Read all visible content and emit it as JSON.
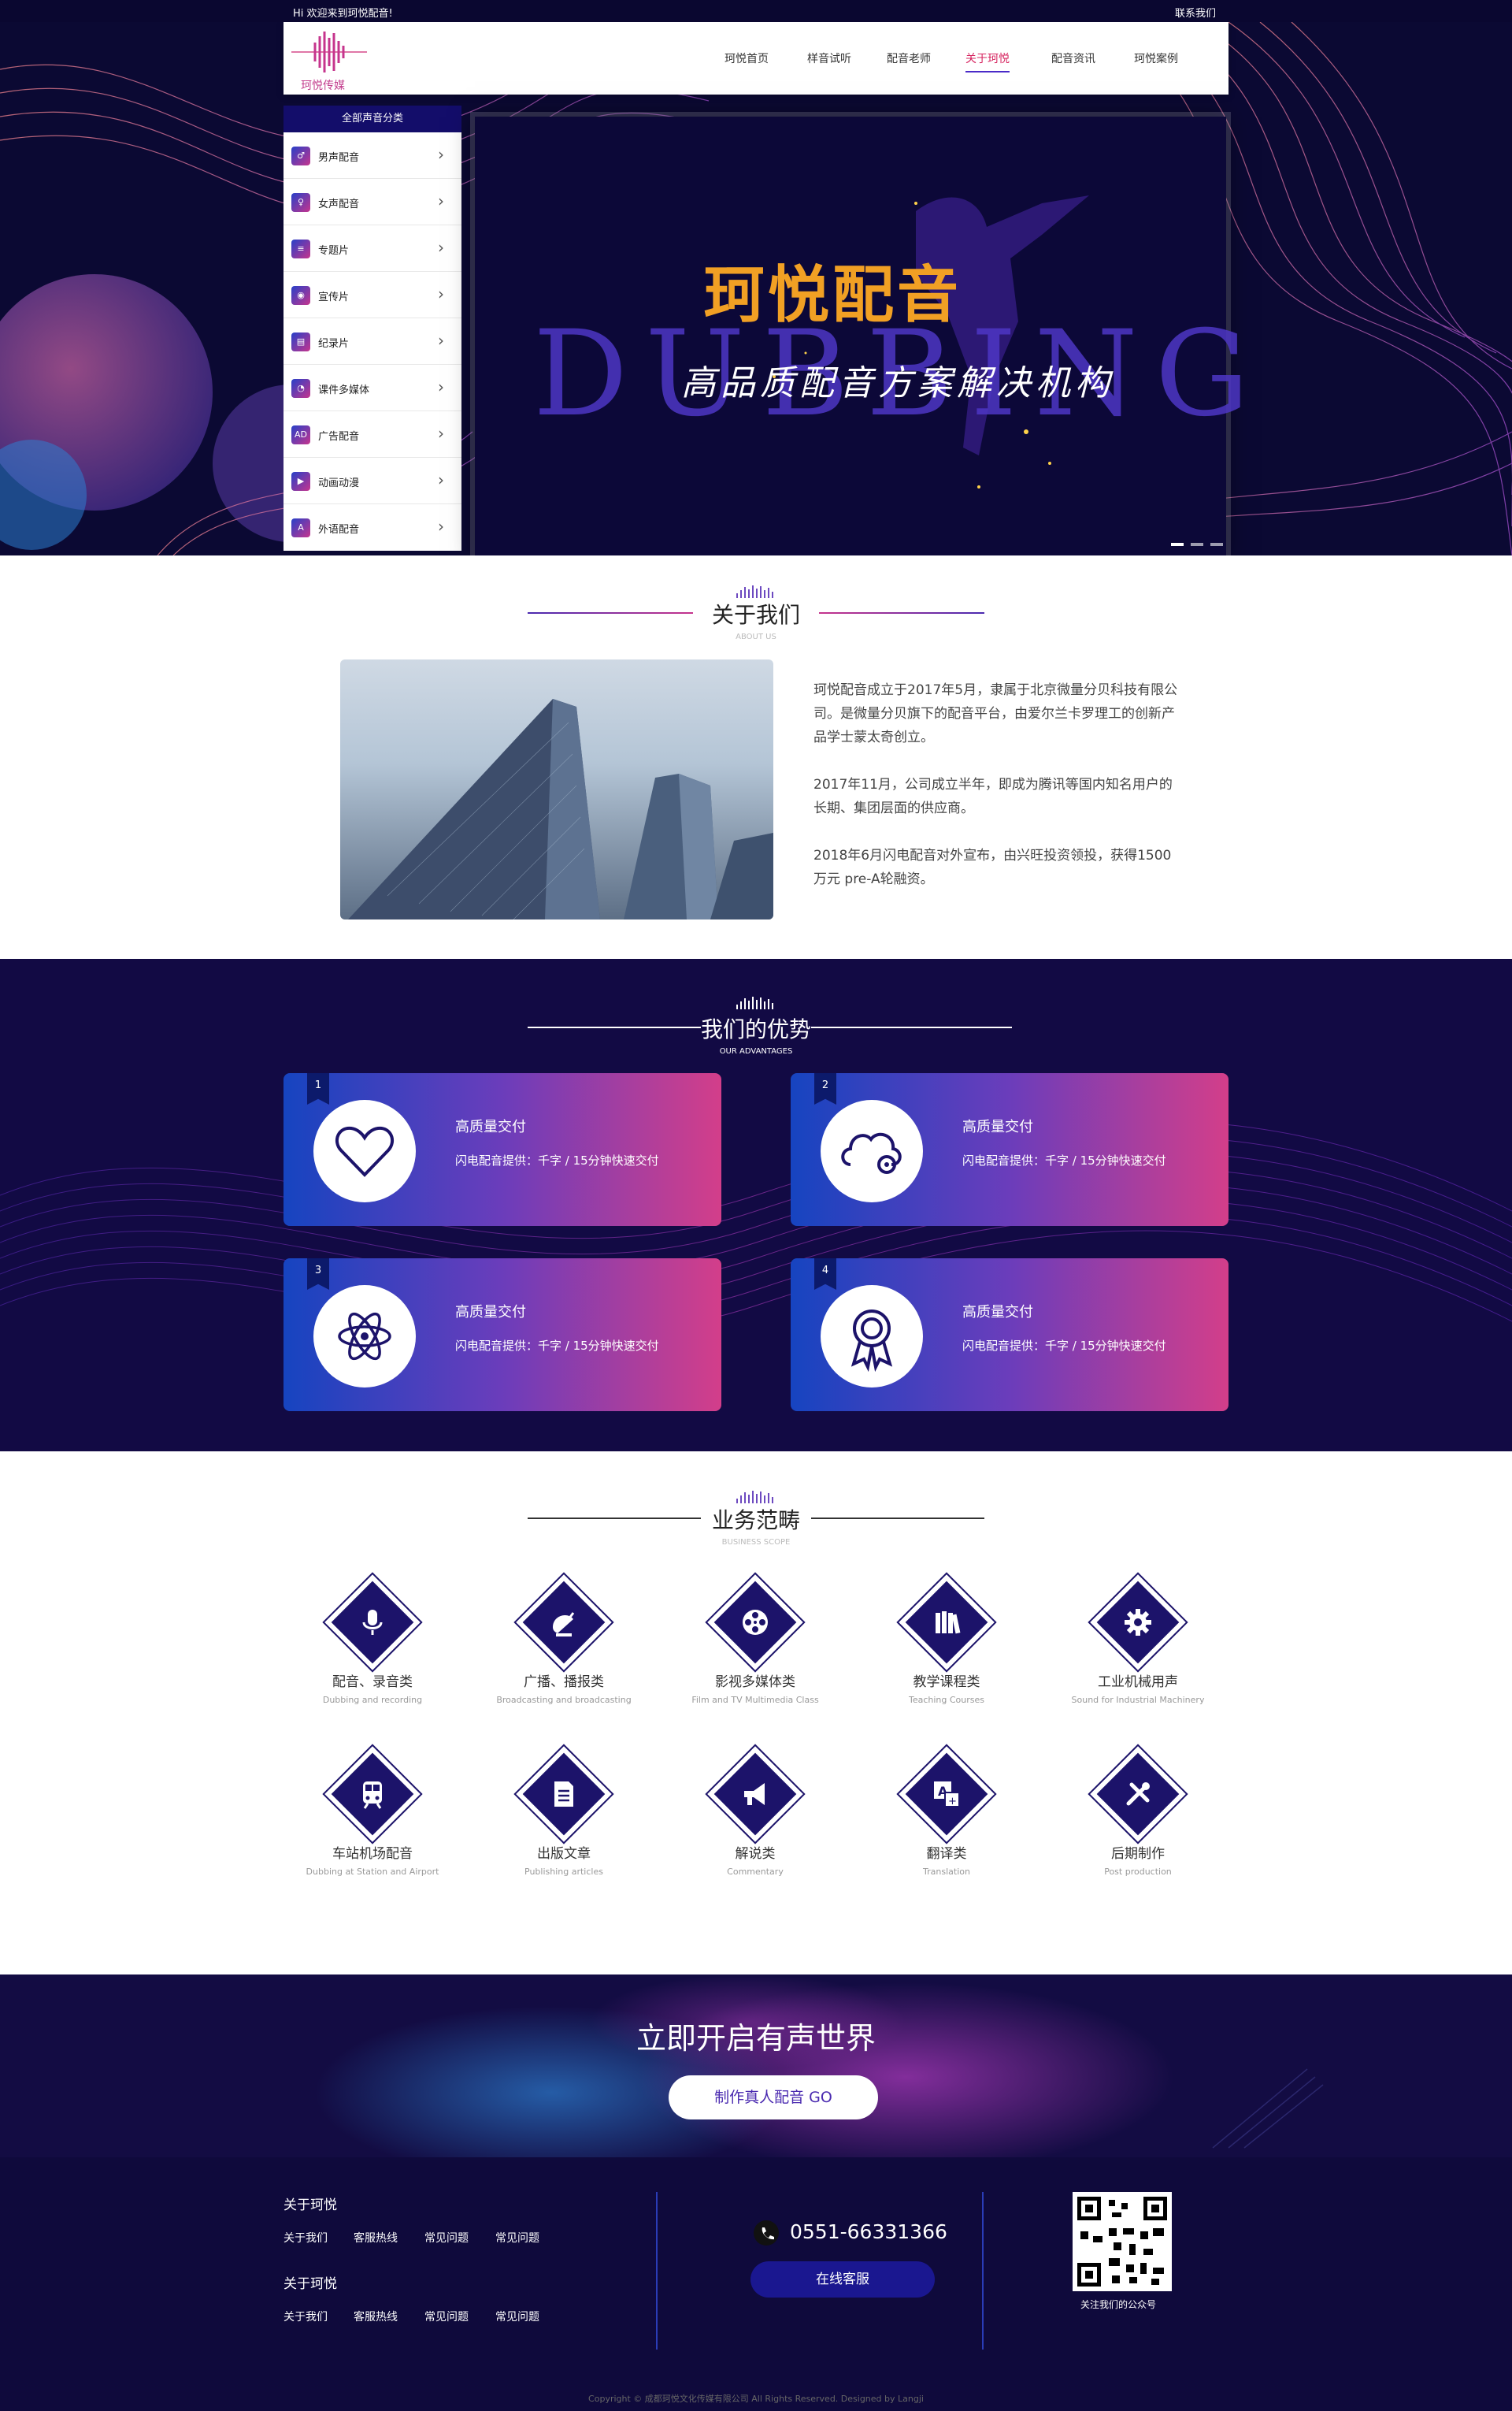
{
  "topbar": {
    "welcome": "Hi 欢迎来到珂悦配音!",
    "contact": "联系我们"
  },
  "brand": {
    "logo_text": "珂悦传媒"
  },
  "nav": [
    {
      "label": "珂悦首页"
    },
    {
      "label": "样音试听"
    },
    {
      "label": "配音老师"
    },
    {
      "label": "关于珂悦",
      "active": true
    },
    {
      "label": "配音资讯"
    },
    {
      "label": "珂悦案例"
    }
  ],
  "categories": {
    "title": "全部声音分类",
    "items": [
      {
        "label": "男声配音",
        "icon": "male-voice-icon",
        "glyph": "♂"
      },
      {
        "label": "女声配音",
        "icon": "female-voice-icon",
        "glyph": "♀"
      },
      {
        "label": "专题片",
        "icon": "document-icon",
        "glyph": "≡"
      },
      {
        "label": "宣传片",
        "icon": "film-reel-icon",
        "glyph": "◉"
      },
      {
        "label": "纪录片",
        "icon": "record-icon",
        "glyph": "▤"
      },
      {
        "label": "课件多媒体",
        "icon": "multimedia-icon",
        "glyph": "◔"
      },
      {
        "label": "广告配音",
        "icon": "ad-icon",
        "glyph": "AD"
      },
      {
        "label": "动画动漫",
        "icon": "camera-icon",
        "glyph": "▶"
      },
      {
        "label": "外语配音",
        "icon": "language-icon",
        "glyph": "A"
      }
    ]
  },
  "banner": {
    "title": "珂悦配音",
    "dub": "DUBBING",
    "subtitle": "高品质配音方案解决机构"
  },
  "about": {
    "title": "关于我们",
    "subtitle": "ABOUT US",
    "paragraphs": [
      "珂悦配音成立于2017年5月，隶属于北京微量分贝科技有限公司。是微量分贝旗下的配音平台，由爱尔兰卡罗理工的创新产品学士蒙太奇创立。",
      "2017年11月，公司成立半年，即成为腾讯等国内知名用户的长期、集团层面的供应商。",
      "2018年6月闪电配音对外宣布，由兴旺投资领投，获得1500万元 pre-A轮融资。"
    ]
  },
  "advantages": {
    "title": "我们的优势",
    "subtitle": "OUR ADVANTAGES",
    "items": [
      {
        "num": "1",
        "title": "高质量交付",
        "desc": "闪电配音提供：千字 / 15分钟快速交付",
        "icon": "heart-icon"
      },
      {
        "num": "2",
        "title": "高质量交付",
        "desc": "闪电配音提供：千字 / 15分钟快速交付",
        "icon": "cloud-gear-icon"
      },
      {
        "num": "3",
        "title": "高质量交付",
        "desc": "闪电配音提供：千字 / 15分钟快速交付",
        "icon": "atom-icon"
      },
      {
        "num": "4",
        "title": "高质量交付",
        "desc": "闪电配音提供：千字 / 15分钟快速交付",
        "icon": "award-icon"
      }
    ]
  },
  "business": {
    "title": "业务范畴",
    "subtitle": "BUSINESS SCOPE",
    "items": [
      {
        "zh": "配音、录音类",
        "en": "Dubbing and recording",
        "icon": "microphone-icon"
      },
      {
        "zh": "广播、播报类",
        "en": "Broadcasting and broadcasting",
        "icon": "satellite-dish-icon"
      },
      {
        "zh": "影视多媒体类",
        "en": "Film and TV Multimedia Class",
        "icon": "film-reel-icon"
      },
      {
        "zh": "教学课程类",
        "en": "Teaching Courses",
        "icon": "books-icon"
      },
      {
        "zh": "工业机械用声",
        "en": "Sound for Industrial Machinery",
        "icon": "gear-icon"
      },
      {
        "zh": "车站机场配音",
        "en": "Dubbing at Station and Airport",
        "icon": "train-icon"
      },
      {
        "zh": "出版文章",
        "en": "Publishing articles",
        "icon": "article-icon"
      },
      {
        "zh": "解说类",
        "en": "Commentary",
        "icon": "megaphone-icon"
      },
      {
        "zh": "翻译类",
        "en": "Translation",
        "icon": "translate-icon"
      },
      {
        "zh": "后期制作",
        "en": "Post production",
        "icon": "tools-icon"
      }
    ]
  },
  "cta": {
    "title": "立即开启有声世界",
    "button": "制作真人配音 GO"
  },
  "footer": {
    "groups": [
      {
        "title": "关于珂悦",
        "links": [
          "关于我们",
          "客服热线",
          "常见问题",
          "常见问题"
        ]
      },
      {
        "title": "关于珂悦",
        "links": [
          "关于我们",
          "客服热线",
          "常见问题",
          "常见问题"
        ]
      }
    ],
    "phone": "0551-66331366",
    "service_button": "在线客服",
    "qr_caption": "关注我们的公众号",
    "copyright": "Copyright © 成都珂悦文化传媒有限公司 All Rights Reserved. Designed by Langji"
  },
  "colors": {
    "navy": "#130d6a",
    "accent_pink": "#d33e8a",
    "accent_blue": "#1644c0",
    "nav_active": "#d6245f"
  }
}
